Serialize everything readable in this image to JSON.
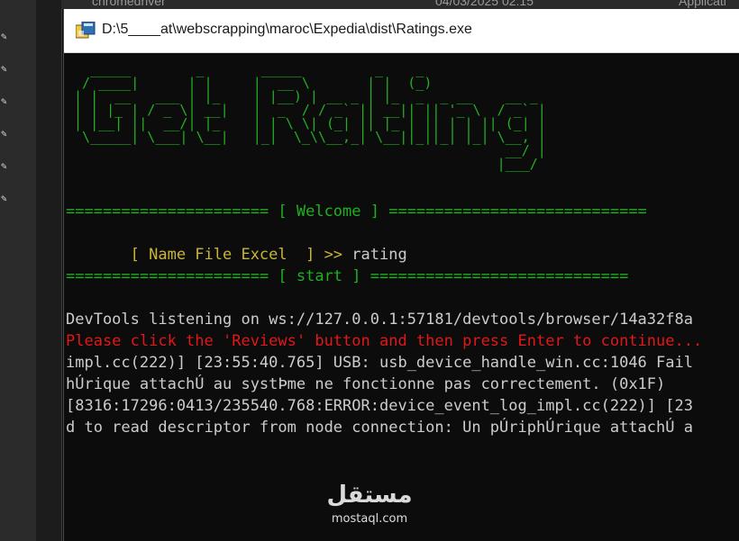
{
  "window": {
    "title": "D:\\5____at\\webscrapping\\maroc\\Expedia\\dist\\Ratings.exe"
  },
  "explorer": {
    "file_name": "chromedriver",
    "file_date": "04/03/2025 02:15",
    "file_type": "Applicati"
  },
  "console": {
    "ascii_banner": [
      "   _____        _       _____         _    _             ",
      "  / ____|      | |     |  __ \\       | |  (_)            ",
      " | |  __   ___ | |_    | |__) | __ _ | |_  _  _ __    __ _",
      " | | |_ | / _ \\| __|   |  _  / / _` || __|| || '_ \\  / _` |",
      " | |__| ||  __/| |_    | | \\ \\| (_| || |_ | || | | || (_| |",
      "  \\_____| \\___| \\__|   |_|  \\_\\\\__,_| \\__||_||_| |_| \\__, |",
      "                                                      __/ |",
      "                                                     |___/ "
    ],
    "welcome_line": "====================== [ Welcome ] ============================",
    "prompt_label": "       [ Name File Excel  ] >>",
    "prompt_value": " rating",
    "start_line": "====================== [ start ] ============================",
    "devtools_line": "DevTools listening on ws://127.0.0.1:57181/devtools/browser/14a32f8a",
    "instruction_line": "Please click the 'Reviews' button and then press Enter to continue...",
    "log_lines": [
      "impl.cc(222)] [23:55:40.765] USB: usb_device_handle_win.cc:1046 Fail",
      "hÚrique attachÚ au systÞme ne fonctionne pas correctement. (0x1F)",
      "[8316:17296:0413/235540.768:ERROR:device_event_log_impl.cc(222)] [23",
      "d to read descriptor from node connection: Un pÚriphÚrique attachÚ a"
    ]
  },
  "watermark": {
    "logo": "مستقل",
    "domain": "mostaql.com"
  },
  "colors": {
    "console_bg": "#0c0c0c",
    "green": "#1fb01f",
    "yellow": "#c9b43a",
    "error_red": "#e21818",
    "text": "#cccccc"
  }
}
